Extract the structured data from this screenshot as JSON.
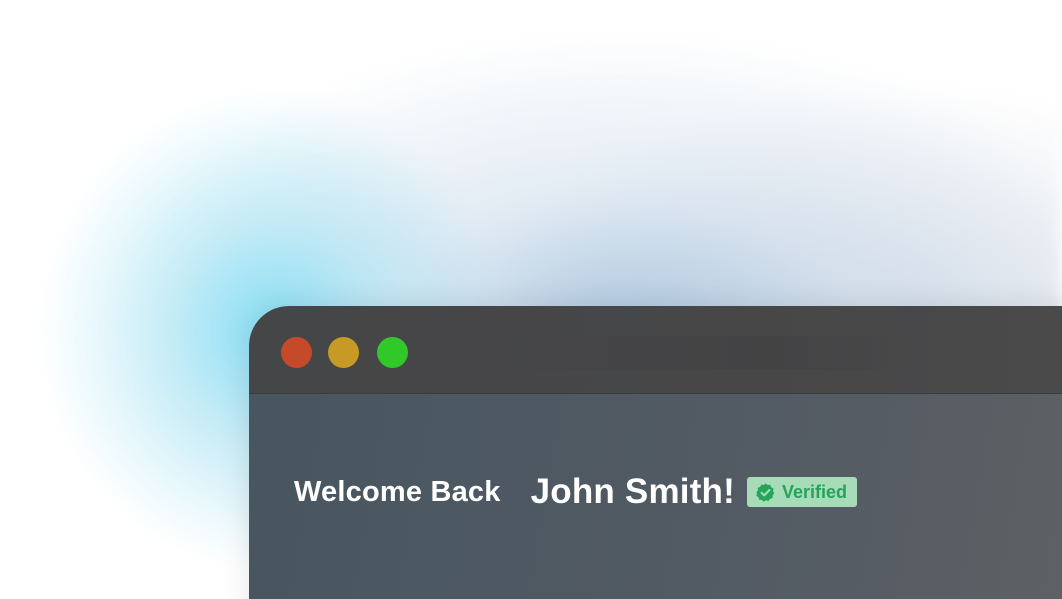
{
  "window": {
    "traffic_lights": [
      {
        "name": "close",
        "color": "#c64a29"
      },
      {
        "name": "minimize",
        "color": "#c79a25"
      },
      {
        "name": "maximize",
        "color": "#31c92a"
      }
    ]
  },
  "content": {
    "greeting": "Welcome Back",
    "user_name": "John Smith!",
    "badge": {
      "label": "Verified",
      "icon": "verified-check-icon",
      "background": "#a8dcb8",
      "text_color": "#23a45a"
    }
  }
}
